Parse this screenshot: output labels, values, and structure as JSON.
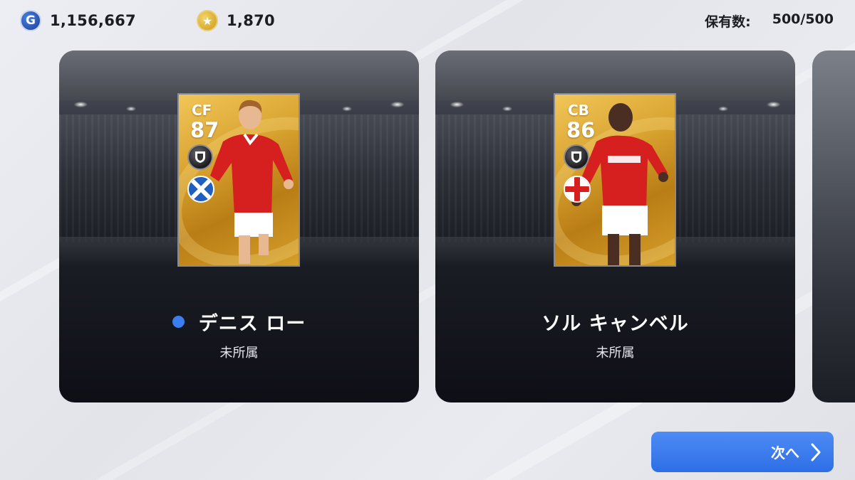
{
  "header": {
    "gp": {
      "icon": "gp-icon",
      "icon_letter": "G",
      "value": "1,156,667"
    },
    "coins": {
      "icon": "coin-icon",
      "icon_symbol": "★",
      "value": "1,870"
    },
    "holdings": {
      "label": "保有数:",
      "value": "500/500"
    }
  },
  "cards": [
    {
      "position": "CF",
      "rating": "87",
      "name": "デニス ロー",
      "club": "未所属",
      "flag": "scotland-flag-icon",
      "new_indicator": "blue-dot-icon",
      "jersey_color": "#d6201f"
    },
    {
      "position": "CB",
      "rating": "86",
      "name": "ソル キャンベル",
      "club": "未所属",
      "flag": "england-flag-icon",
      "jersey_color": "#d6201f"
    }
  ],
  "footer": {
    "next_label": "次へ",
    "next_icon": "chevron-right-icon"
  },
  "colors": {
    "accent": "#3b7ef0",
    "card_gold": "#d9a431"
  }
}
